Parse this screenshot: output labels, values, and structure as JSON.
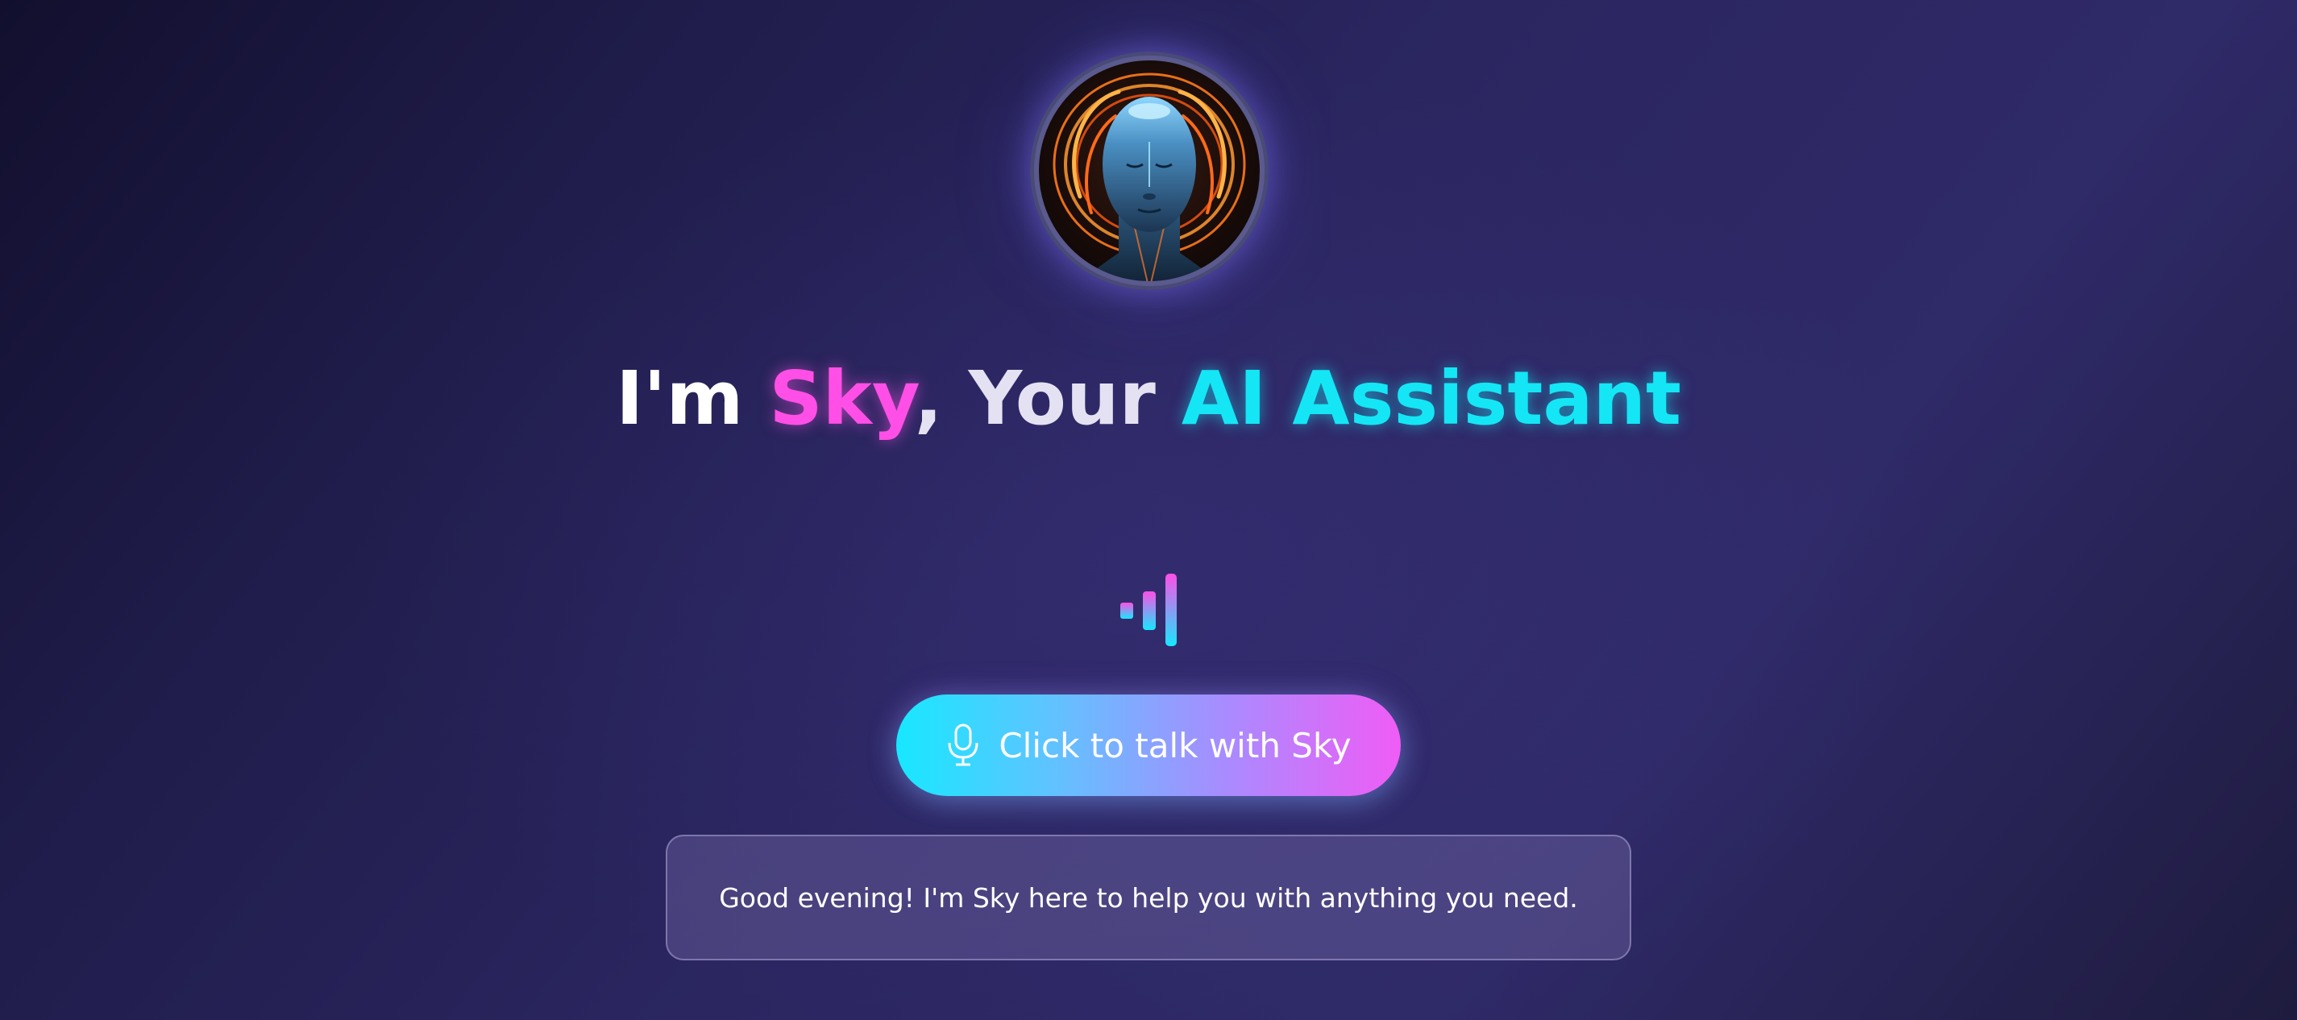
{
  "header": {
    "title_prefix": "I'm",
    "assistant_name": "Sky",
    "title_middle": ", Your",
    "title_suffix": "AI Assistant"
  },
  "avatar": {
    "icon": "assistant-avatar"
  },
  "voice_indicator": {
    "icon": "audio-wave-icon"
  },
  "talk_button": {
    "label": "Click to talk with Sky",
    "icon": "microphone-icon"
  },
  "message": {
    "text": "Good evening! I'm Sky here to help you with anything you need."
  },
  "colors": {
    "pink_accent": "#ff4fe6",
    "cyan_accent": "#14e6f5",
    "background_dark": "#1f1c4a",
    "background_mid": "#2f2a68"
  }
}
